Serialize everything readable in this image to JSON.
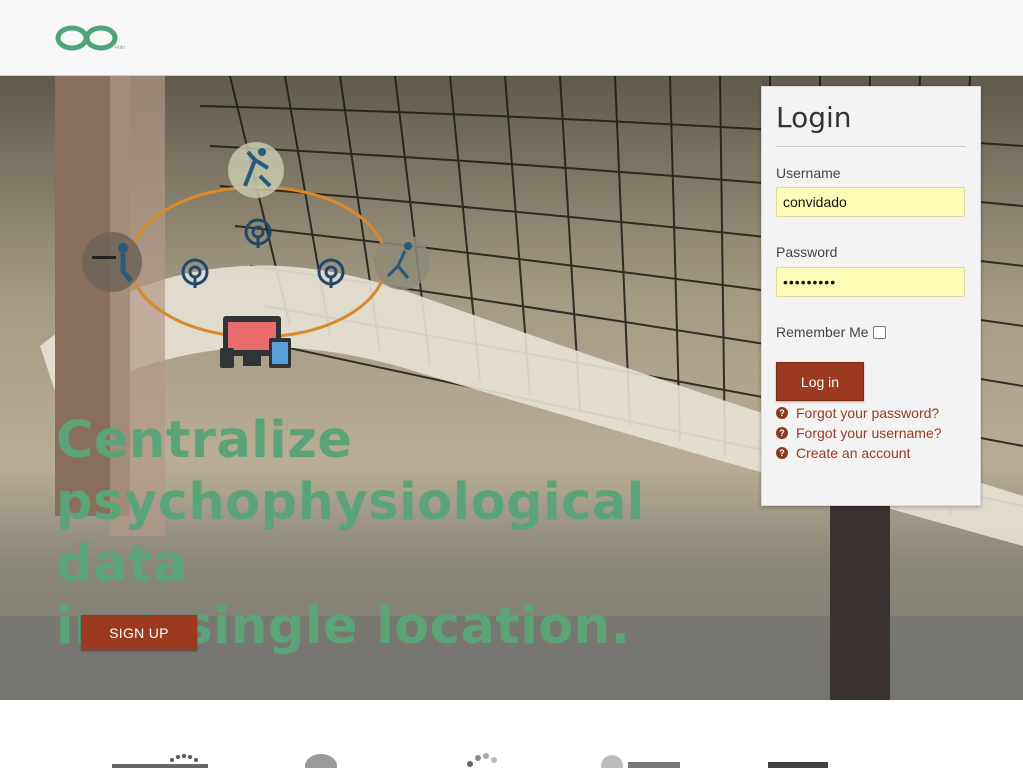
{
  "header": {
    "logo_tiny_text": "+info"
  },
  "hero": {
    "headline": "Centralize\npsychophysiological data\nin a single location.",
    "signup_label": "SIGN UP"
  },
  "login": {
    "title": "Login",
    "username_label": "Username",
    "username_value": "convidado",
    "password_label": "Password",
    "password_value": "•••••••••",
    "remember_label": "Remember Me",
    "login_button": "Log in",
    "links": [
      {
        "icon": "?",
        "label": "Forgot your password?"
      },
      {
        "icon": "?",
        "label": "Forgot your username?"
      },
      {
        "icon": "?",
        "label": "Create an account"
      }
    ]
  },
  "colors": {
    "accent": "#9b3a20",
    "headline": "#5ba47a",
    "logo": "#4fa37a",
    "input_bg": "#fcfcb7"
  }
}
